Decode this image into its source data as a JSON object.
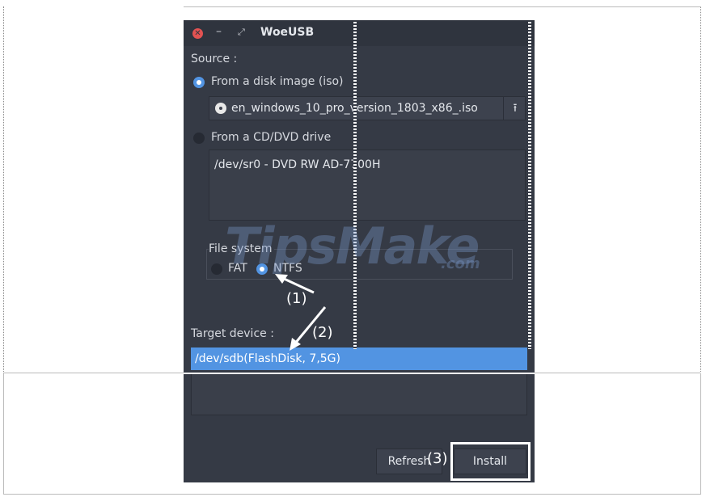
{
  "window": {
    "title": "WoeUSB",
    "close_icon": "close-icon",
    "minimize_icon": "minimize-icon",
    "restore_icon": "restore-icon"
  },
  "source": {
    "label": "Source :",
    "disk_image_option": "From a disk image (iso)",
    "iso_file": "en_windows_10_pro_version_1803_x86_.iso",
    "cd_option": "From a CD/DVD drive",
    "drive_entry": "/dev/sr0 - DVD RW AD-7700H"
  },
  "filesystem": {
    "label": "File system",
    "fat": "FAT",
    "ntfs": "NTFS",
    "selected": "NTFS"
  },
  "target": {
    "label": "Target device :",
    "selected_device": "/dev/sdb(FlashDisk, 7,5G)"
  },
  "buttons": {
    "refresh": "Refresh",
    "install": "Install"
  },
  "annotations": {
    "step1": "(1)",
    "step2": "(2)",
    "step3": "(3)"
  },
  "watermark": {
    "text": "TipsMake",
    "suffix": ".com"
  },
  "colors": {
    "window_bg": "#353a45",
    "accent": "#5294e2",
    "close": "#e25252"
  }
}
